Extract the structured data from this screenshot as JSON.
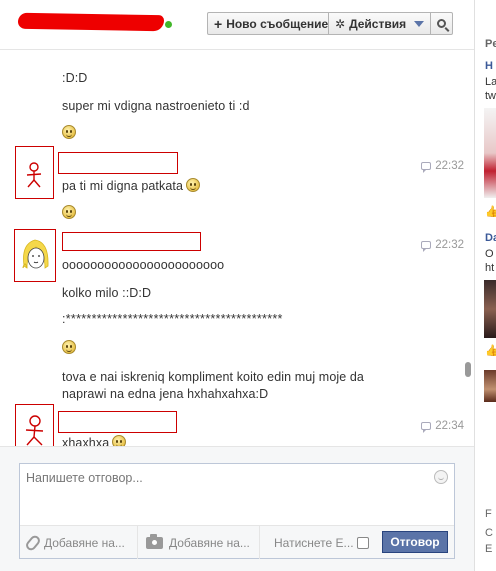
{
  "header": {
    "new_message_label": "Ново съобщение",
    "actions_label": "Действия"
  },
  "thread": {
    "lines": {
      "l1": ":D:D",
      "l2": "super mi vdigna nastroenieto ti :d",
      "m1_text": "pa ti mi digna patkata",
      "m1_time": "22:32",
      "m2_text1": "ooooooooooooooooooooooo",
      "m2_time": "22:32",
      "m2_text2": "kolko milo ::D:D",
      "m2_text3": ":******************************************",
      "m2_text4a": "tova e nai iskreniq kompliment koito edin muj moje da",
      "m2_text4b": "naprawi na edna jena hxhahxahxa:D",
      "m3_text": "xhaxhxa",
      "m3_time": "22:34"
    }
  },
  "reply": {
    "placeholder": "Напишете отговор...",
    "attach_label": "Добавяне на...",
    "photo_label": "Добавяне на...",
    "enter_label": "Натиснете E...",
    "send_label": "Отговор"
  },
  "right_column": {
    "t1": "Pe",
    "t2": "H",
    "t3": "La",
    "t4": "tw",
    "t5": "Da",
    "t6": "O",
    "t7": "ht",
    "t8": "F",
    "t9": "C",
    "t10": "E"
  },
  "colors": {
    "accent": "#5b74a8",
    "redaction": "#e00000",
    "online": "#42b72a"
  }
}
